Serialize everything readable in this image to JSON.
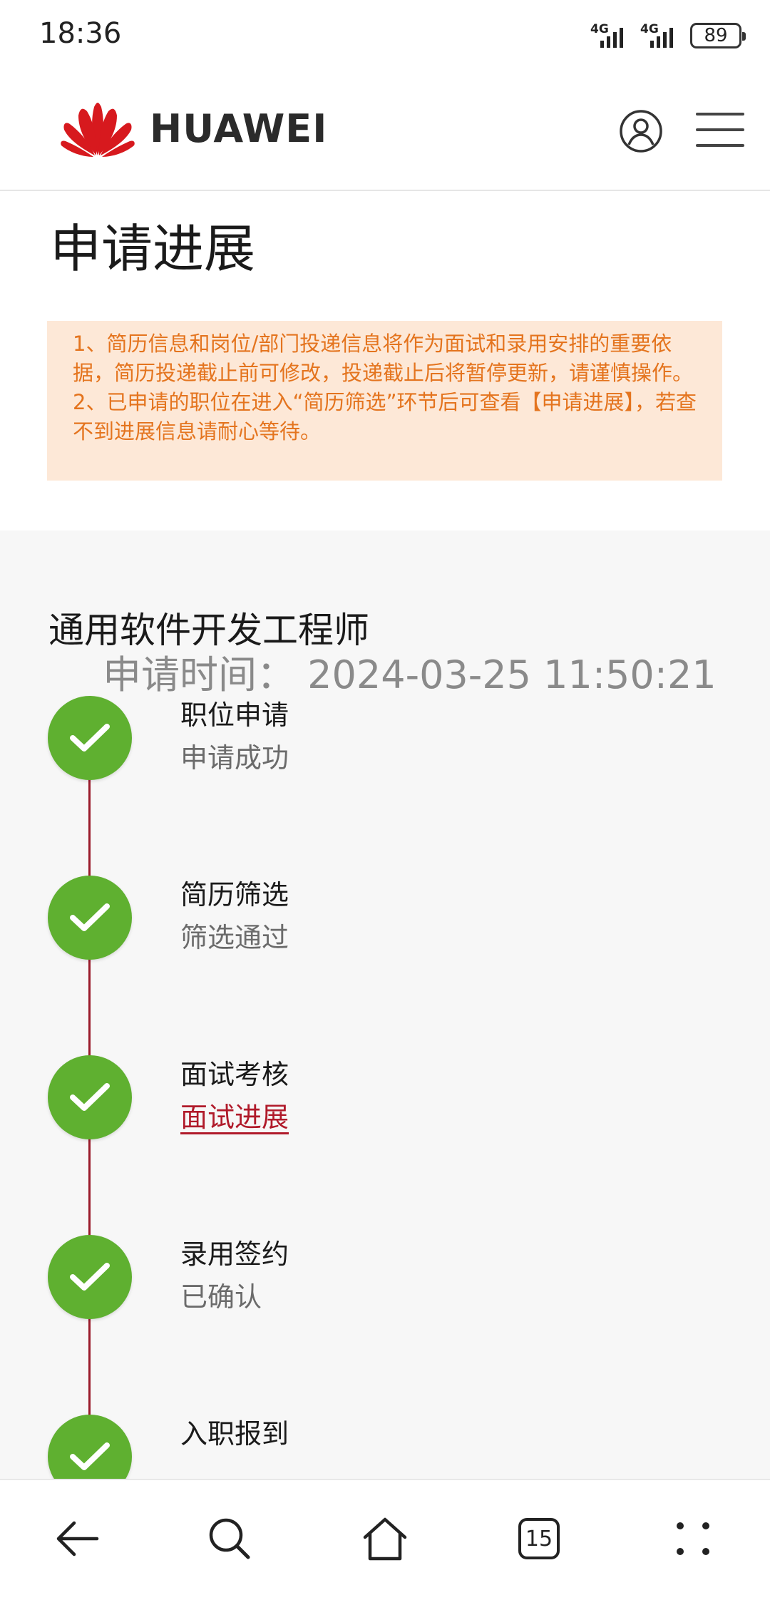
{
  "status_bar": {
    "time": "18:36",
    "network_1": "4G",
    "network_2": "4G",
    "battery": "89"
  },
  "header": {
    "brand": "HUAWEI",
    "brand_color": "#d7191e"
  },
  "page": {
    "title": "申请进展",
    "notice_lines": [
      "1、简历信息和岗位/部门投递信息将作为面试和录用安排的重要依据，简历投递截止前可修改，投递截止后将暂停更新，请谨慎操作。",
      "2、已申请的职位在进入“简历筛选”环节后可查看【申请进展】，若查不到进展信息请耐心等待。"
    ]
  },
  "application": {
    "job_title": "通用软件开发工程师",
    "apply_time": "申请时间：  2024-03-25 11:50:21",
    "steps": [
      {
        "name": "职位申请",
        "status": "申请成功"
      },
      {
        "name": "简历筛选",
        "status": "筛选通过"
      },
      {
        "name": "面试考核",
        "status": "面试进展"
      },
      {
        "name": "录用签约",
        "status": "已确认"
      },
      {
        "name": "入职报到",
        "status": ""
      }
    ]
  },
  "bottom_nav": {
    "tabs_count": "15"
  },
  "colors": {
    "check_green": "#5fb030",
    "timeline_red": "#9a1b2b",
    "notice_bg": "#fde8d7",
    "notice_text": "#e4741e",
    "link_red": "#b01a2a"
  }
}
